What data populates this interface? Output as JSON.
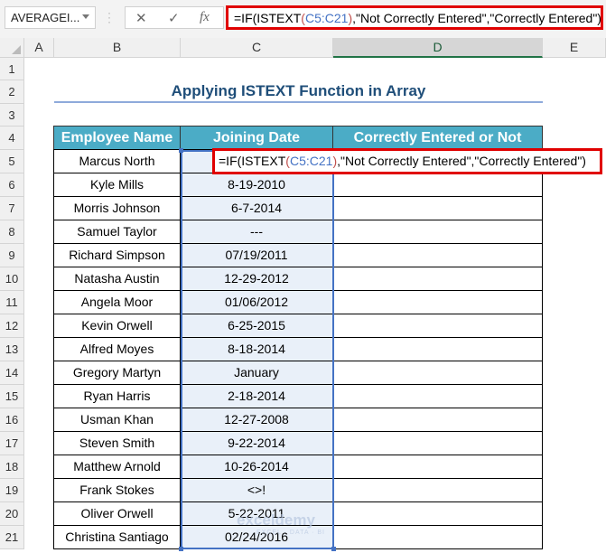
{
  "name_box": "AVERAGEI...",
  "formula_bar": {
    "cancel": "✕",
    "enter": "✓",
    "fx": "fx",
    "prefix": "=IF(ISTEXT",
    "open": "(",
    "ref": "C5:C21",
    "close": ")",
    "suffix": ",\"Not Correctly Entered\",\"Correctly Entered\")"
  },
  "columns": [
    "A",
    "B",
    "C",
    "D",
    "E"
  ],
  "rows": [
    "1",
    "2",
    "3",
    "4",
    "5",
    "6",
    "7",
    "8",
    "9",
    "10",
    "11",
    "12",
    "13",
    "14",
    "15",
    "16",
    "17",
    "18",
    "19",
    "20",
    "21"
  ],
  "title": "Applying ISTEXT Function in Array",
  "table": {
    "headers": [
      "Employee Name",
      "Joining Date",
      "Correctly Entered or Not"
    ],
    "rows": [
      [
        "Marcus North",
        ""
      ],
      [
        "Kyle Mills",
        "8-19-2010"
      ],
      [
        "Morris Johnson",
        "6-7-2014"
      ],
      [
        "Samuel Taylor",
        "---"
      ],
      [
        "Richard Simpson",
        "07/19/2011"
      ],
      [
        "Natasha Austin",
        "12-29-2012"
      ],
      [
        "Angela Moor",
        "01/06/2012"
      ],
      [
        "Kevin Orwell",
        "6-25-2015"
      ],
      [
        "Alfred Moyes",
        "8-18-2014"
      ],
      [
        "Gregory Martyn",
        "January"
      ],
      [
        "Ryan Harris",
        "2-18-2014"
      ],
      [
        "Usman Khan",
        "12-27-2008"
      ],
      [
        "Steven Smith",
        "9-22-2014"
      ],
      [
        "Matthew Arnold",
        "10-26-2014"
      ],
      [
        "Frank Stokes",
        "<>!"
      ],
      [
        "Oliver Orwell",
        "5-22-2011"
      ],
      [
        "Christina Santiago",
        "02/24/2016"
      ]
    ]
  },
  "watermark": {
    "name": "exceldemy",
    "tagline": "EXCEL · DATA · BI"
  }
}
